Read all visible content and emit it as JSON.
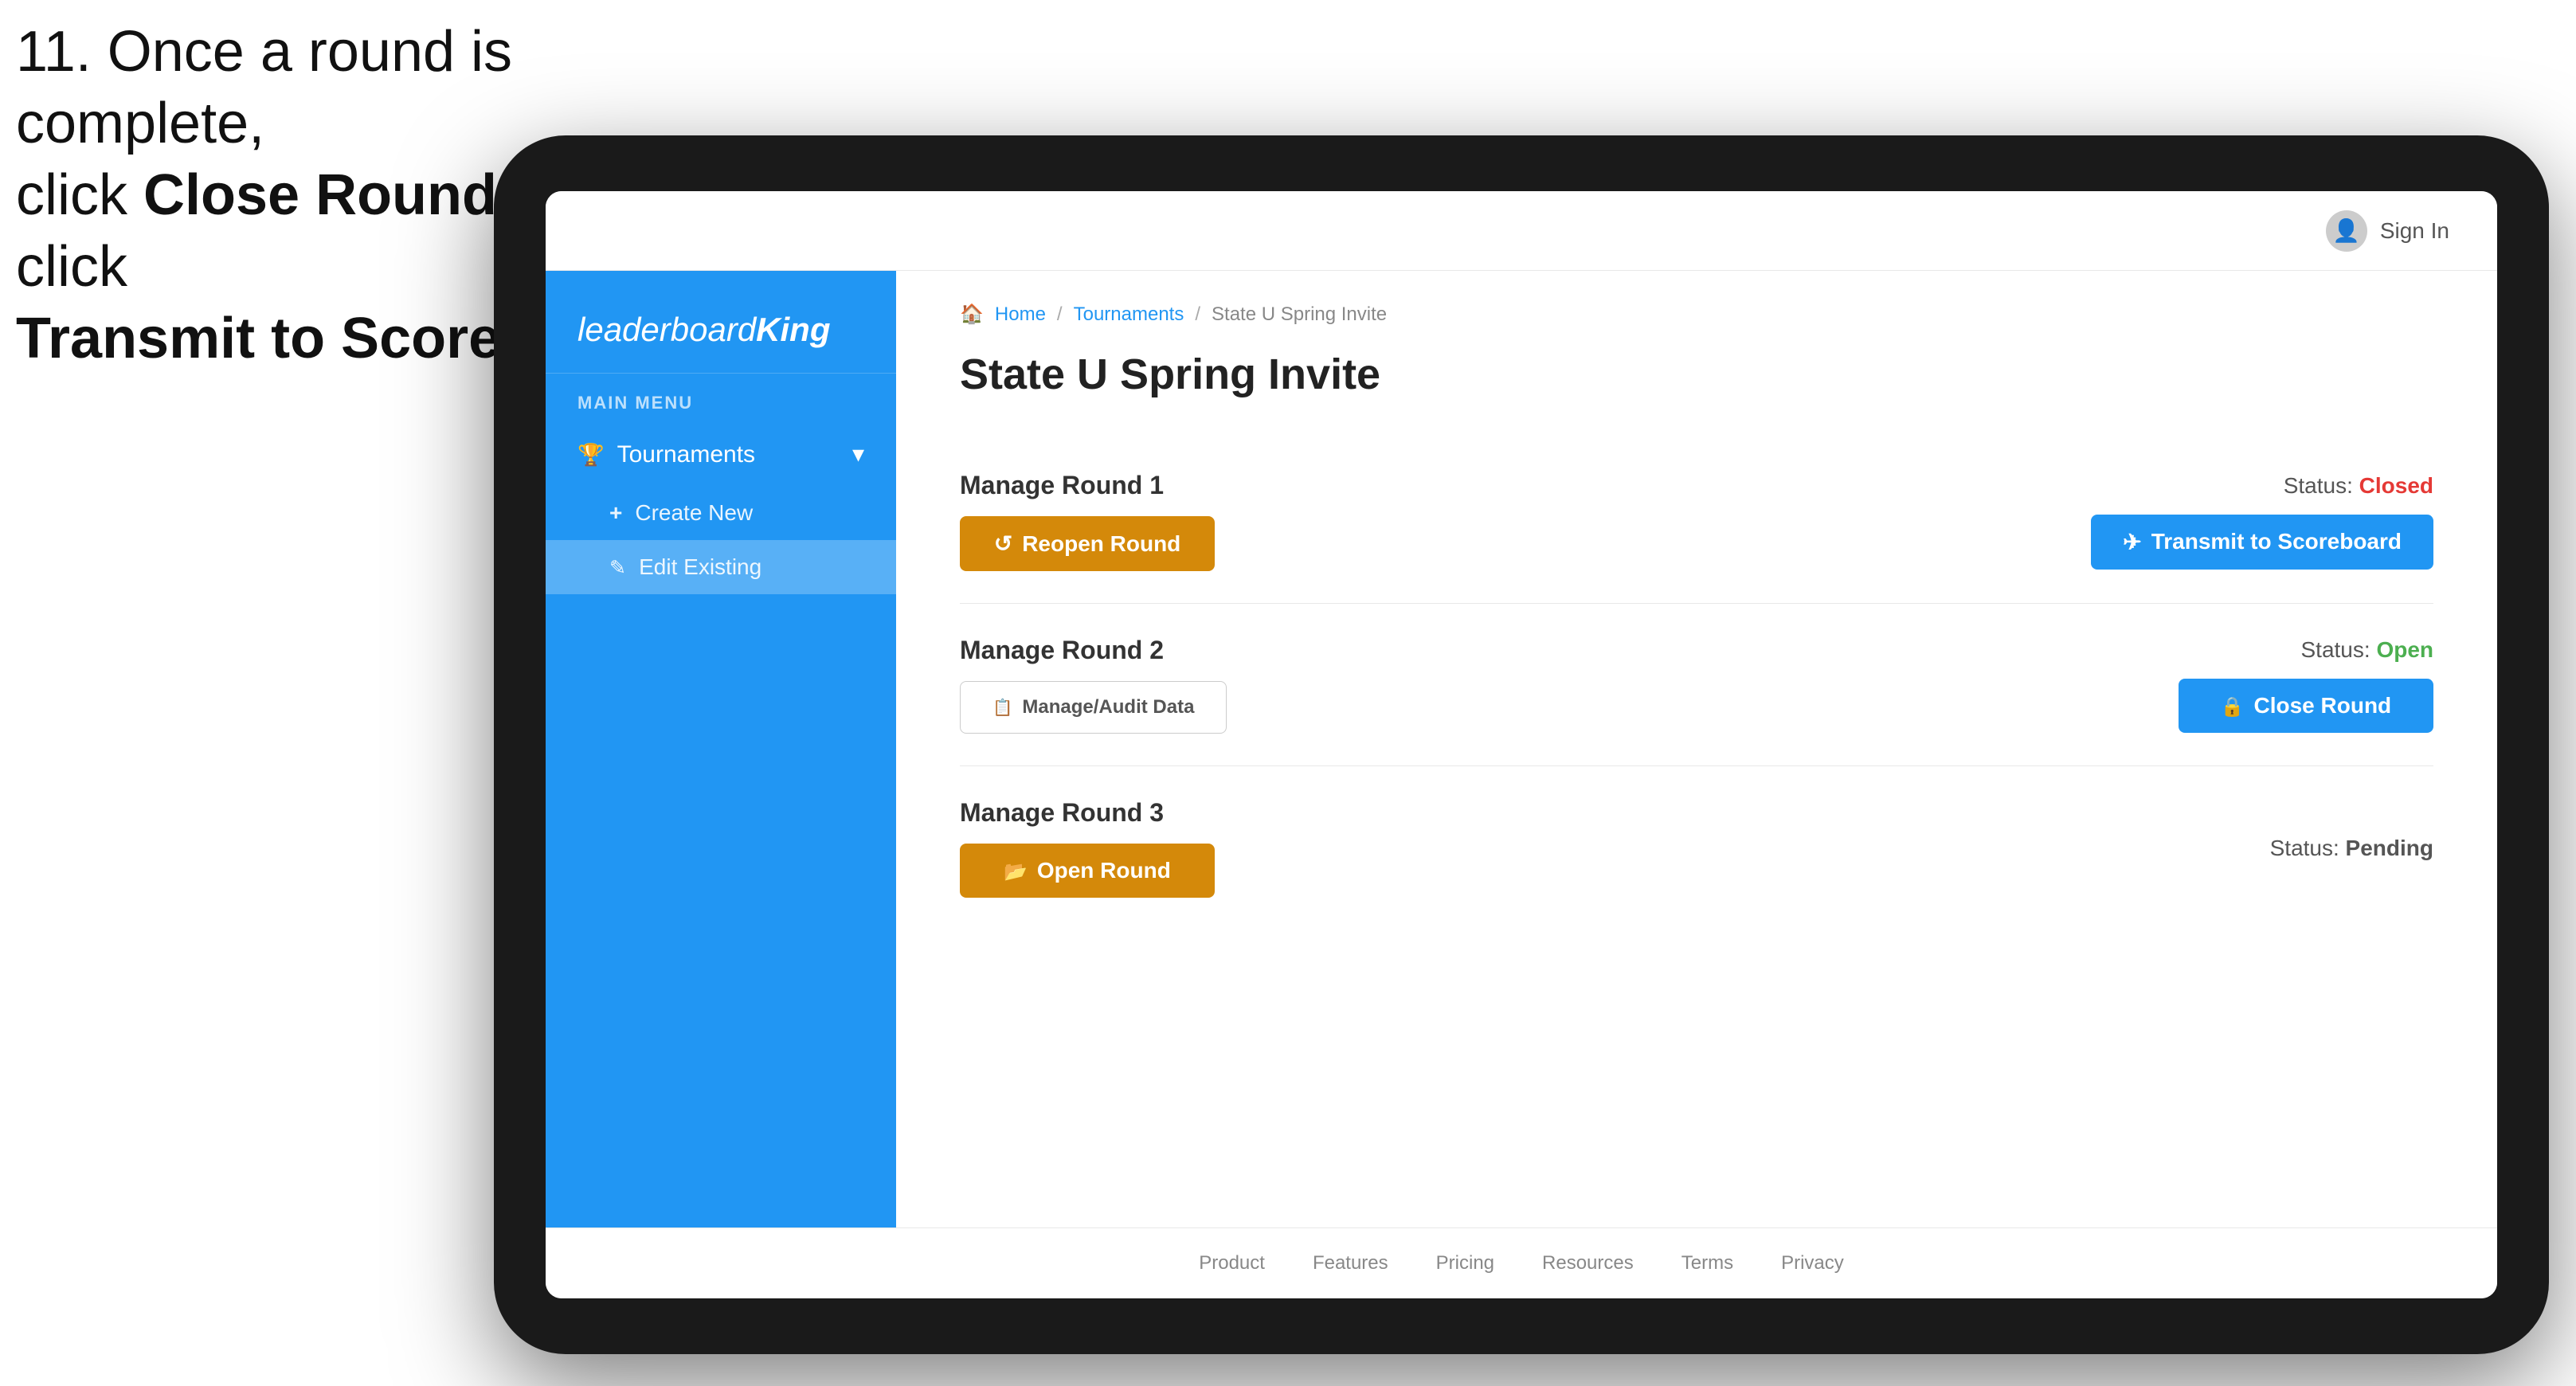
{
  "instruction": {
    "line1": "11. Once a round is complete,",
    "line2_pre": "click ",
    "line2_bold": "Close Round",
    "line2_post": " then click",
    "line3_bold": "Transmit to Scoreboard."
  },
  "header": {
    "sign_in": "Sign In"
  },
  "sidebar": {
    "logo": "leaderboardKing",
    "logo_leaderboard": "leaderboard",
    "logo_king": "King",
    "main_menu_label": "MAIN MENU",
    "tournaments_label": "Tournaments",
    "create_new_label": "Create New",
    "edit_existing_label": "Edit Existing"
  },
  "breadcrumb": {
    "home": "Home",
    "sep1": "/",
    "tournaments": "Tournaments",
    "sep2": "/",
    "current": "State U Spring Invite"
  },
  "page_title": "State U Spring Invite",
  "rounds": [
    {
      "id": 1,
      "title": "Manage Round 1",
      "status_label": "Status:",
      "status_value": "Closed",
      "status_class": "status-closed",
      "left_button": "Reopen Round",
      "right_button": "Transmit to Scoreboard",
      "left_btn_class": "btn-gold",
      "right_btn_class": "btn-blue"
    },
    {
      "id": 2,
      "title": "Manage Round 2",
      "status_label": "Status:",
      "status_value": "Open",
      "status_class": "status-open",
      "left_button": "Manage/Audit Data",
      "right_button": "Close Round",
      "left_btn_class": "btn-outline",
      "right_btn_class": "btn-blue"
    },
    {
      "id": 3,
      "title": "Manage Round 3",
      "status_label": "Status:",
      "status_value": "Pending",
      "status_class": "status-pending",
      "left_button": "Open Round",
      "right_button": null,
      "left_btn_class": "btn-gold",
      "right_btn_class": null
    }
  ],
  "footer": {
    "links": [
      "Product",
      "Features",
      "Pricing",
      "Resources",
      "Terms",
      "Privacy"
    ]
  }
}
